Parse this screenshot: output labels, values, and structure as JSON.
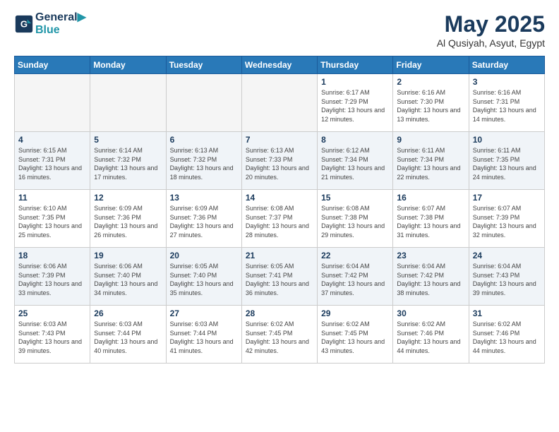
{
  "header": {
    "logo_line1": "General",
    "logo_line2": "Blue",
    "month_year": "May 2025",
    "location": "Al Qusiyah, Asyut, Egypt"
  },
  "weekdays": [
    "Sunday",
    "Monday",
    "Tuesday",
    "Wednesday",
    "Thursday",
    "Friday",
    "Saturday"
  ],
  "weeks": [
    [
      {
        "day": "",
        "empty": true
      },
      {
        "day": "",
        "empty": true
      },
      {
        "day": "",
        "empty": true
      },
      {
        "day": "",
        "empty": true
      },
      {
        "day": "1",
        "sunrise": "6:17 AM",
        "sunset": "7:29 PM",
        "daylight": "13 hours and 12 minutes."
      },
      {
        "day": "2",
        "sunrise": "6:16 AM",
        "sunset": "7:30 PM",
        "daylight": "13 hours and 13 minutes."
      },
      {
        "day": "3",
        "sunrise": "6:16 AM",
        "sunset": "7:31 PM",
        "daylight": "13 hours and 14 minutes."
      }
    ],
    [
      {
        "day": "4",
        "sunrise": "6:15 AM",
        "sunset": "7:31 PM",
        "daylight": "13 hours and 16 minutes."
      },
      {
        "day": "5",
        "sunrise": "6:14 AM",
        "sunset": "7:32 PM",
        "daylight": "13 hours and 17 minutes."
      },
      {
        "day": "6",
        "sunrise": "6:13 AM",
        "sunset": "7:32 PM",
        "daylight": "13 hours and 18 minutes."
      },
      {
        "day": "7",
        "sunrise": "6:13 AM",
        "sunset": "7:33 PM",
        "daylight": "13 hours and 20 minutes."
      },
      {
        "day": "8",
        "sunrise": "6:12 AM",
        "sunset": "7:34 PM",
        "daylight": "13 hours and 21 minutes."
      },
      {
        "day": "9",
        "sunrise": "6:11 AM",
        "sunset": "7:34 PM",
        "daylight": "13 hours and 22 minutes."
      },
      {
        "day": "10",
        "sunrise": "6:11 AM",
        "sunset": "7:35 PM",
        "daylight": "13 hours and 24 minutes."
      }
    ],
    [
      {
        "day": "11",
        "sunrise": "6:10 AM",
        "sunset": "7:35 PM",
        "daylight": "13 hours and 25 minutes."
      },
      {
        "day": "12",
        "sunrise": "6:09 AM",
        "sunset": "7:36 PM",
        "daylight": "13 hours and 26 minutes."
      },
      {
        "day": "13",
        "sunrise": "6:09 AM",
        "sunset": "7:36 PM",
        "daylight": "13 hours and 27 minutes."
      },
      {
        "day": "14",
        "sunrise": "6:08 AM",
        "sunset": "7:37 PM",
        "daylight": "13 hours and 28 minutes."
      },
      {
        "day": "15",
        "sunrise": "6:08 AM",
        "sunset": "7:38 PM",
        "daylight": "13 hours and 29 minutes."
      },
      {
        "day": "16",
        "sunrise": "6:07 AM",
        "sunset": "7:38 PM",
        "daylight": "13 hours and 31 minutes."
      },
      {
        "day": "17",
        "sunrise": "6:07 AM",
        "sunset": "7:39 PM",
        "daylight": "13 hours and 32 minutes."
      }
    ],
    [
      {
        "day": "18",
        "sunrise": "6:06 AM",
        "sunset": "7:39 PM",
        "daylight": "13 hours and 33 minutes."
      },
      {
        "day": "19",
        "sunrise": "6:06 AM",
        "sunset": "7:40 PM",
        "daylight": "13 hours and 34 minutes."
      },
      {
        "day": "20",
        "sunrise": "6:05 AM",
        "sunset": "7:40 PM",
        "daylight": "13 hours and 35 minutes."
      },
      {
        "day": "21",
        "sunrise": "6:05 AM",
        "sunset": "7:41 PM",
        "daylight": "13 hours and 36 minutes."
      },
      {
        "day": "22",
        "sunrise": "6:04 AM",
        "sunset": "7:42 PM",
        "daylight": "13 hours and 37 minutes."
      },
      {
        "day": "23",
        "sunrise": "6:04 AM",
        "sunset": "7:42 PM",
        "daylight": "13 hours and 38 minutes."
      },
      {
        "day": "24",
        "sunrise": "6:04 AM",
        "sunset": "7:43 PM",
        "daylight": "13 hours and 39 minutes."
      }
    ],
    [
      {
        "day": "25",
        "sunrise": "6:03 AM",
        "sunset": "7:43 PM",
        "daylight": "13 hours and 39 minutes."
      },
      {
        "day": "26",
        "sunrise": "6:03 AM",
        "sunset": "7:44 PM",
        "daylight": "13 hours and 40 minutes."
      },
      {
        "day": "27",
        "sunrise": "6:03 AM",
        "sunset": "7:44 PM",
        "daylight": "13 hours and 41 minutes."
      },
      {
        "day": "28",
        "sunrise": "6:02 AM",
        "sunset": "7:45 PM",
        "daylight": "13 hours and 42 minutes."
      },
      {
        "day": "29",
        "sunrise": "6:02 AM",
        "sunset": "7:45 PM",
        "daylight": "13 hours and 43 minutes."
      },
      {
        "day": "30",
        "sunrise": "6:02 AM",
        "sunset": "7:46 PM",
        "daylight": "13 hours and 44 minutes."
      },
      {
        "day": "31",
        "sunrise": "6:02 AM",
        "sunset": "7:46 PM",
        "daylight": "13 hours and 44 minutes."
      }
    ]
  ]
}
